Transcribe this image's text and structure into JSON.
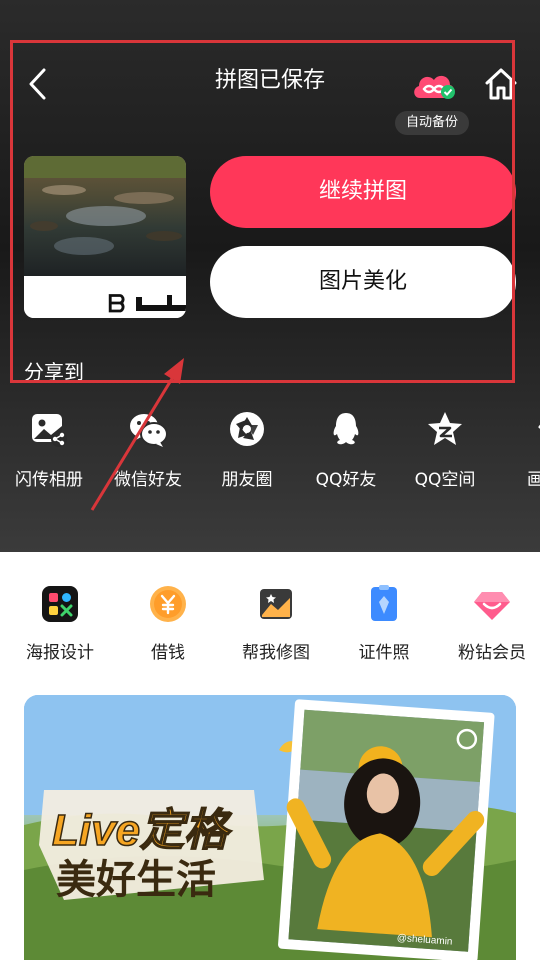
{
  "header": {
    "title": "拼图已保存",
    "backup_label": "自动备份"
  },
  "preview": {
    "watermark": "ᗷ"
  },
  "actions": {
    "continue_label": "继续拼图",
    "beautify_label": "图片美化"
  },
  "share": {
    "label": "分享到",
    "items": [
      {
        "label": "闪传相册",
        "icon": "gallery-share-icon"
      },
      {
        "label": "微信好友",
        "icon": "wechat-icon"
      },
      {
        "label": "朋友圈",
        "icon": "moments-icon"
      },
      {
        "label": "QQ好友",
        "icon": "qq-icon"
      },
      {
        "label": "QQ空间",
        "icon": "qzone-icon"
      },
      {
        "label": "画",
        "icon": "weibo-icon"
      }
    ]
  },
  "services": [
    {
      "label": "海报设计",
      "icon": "poster-design-icon"
    },
    {
      "label": "借钱",
      "icon": "yuan-coin-icon"
    },
    {
      "label": "帮我修图",
      "icon": "photo-retouch-icon"
    },
    {
      "label": "证件照",
      "icon": "id-photo-icon"
    },
    {
      "label": "粉钻会员",
      "icon": "pink-diamond-icon"
    }
  ],
  "banner": {
    "line1": "Live定格",
    "line2": "美好生活",
    "photo_caption": "@sheluamin"
  },
  "colors": {
    "accent": "#ff3759",
    "annotation": "#d9363a"
  }
}
